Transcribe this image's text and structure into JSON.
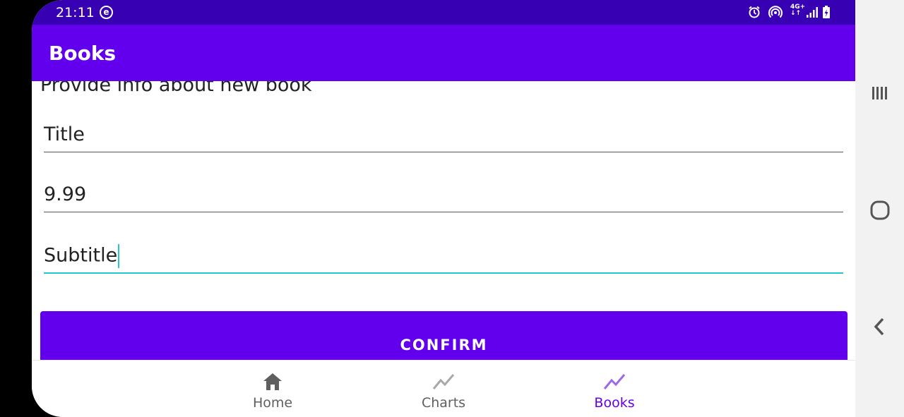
{
  "status_bar": {
    "time": "21:11",
    "notification_icon": "e-circle-icon",
    "network": [
      "4G+",
      "↓↑"
    ],
    "icons": [
      "alarm-icon",
      "hotspot-icon",
      "signal-icon",
      "battery-charging-icon"
    ]
  },
  "app_bar": {
    "title": "Books"
  },
  "form": {
    "heading": "Provide info about new book",
    "fields": [
      {
        "value": "Title"
      },
      {
        "value": "9.99"
      },
      {
        "value": "Subtitle",
        "focused": true
      }
    ],
    "confirm_label": "CONFIRM"
  },
  "bottom_nav": {
    "items": [
      {
        "label": "Home",
        "icon": "home-icon"
      },
      {
        "label": "Charts",
        "icon": "trending-up-icon"
      },
      {
        "label": "Books",
        "icon": "trending-up-icon",
        "active": true
      }
    ]
  },
  "system_nav": [
    "recent-apps-icon",
    "home-icon",
    "back-icon"
  ],
  "colors": {
    "primary": "#6200ee",
    "primary_dark": "#3700b3",
    "accent": "#22c8cc",
    "nav_inactive": "#5f5f5f"
  }
}
